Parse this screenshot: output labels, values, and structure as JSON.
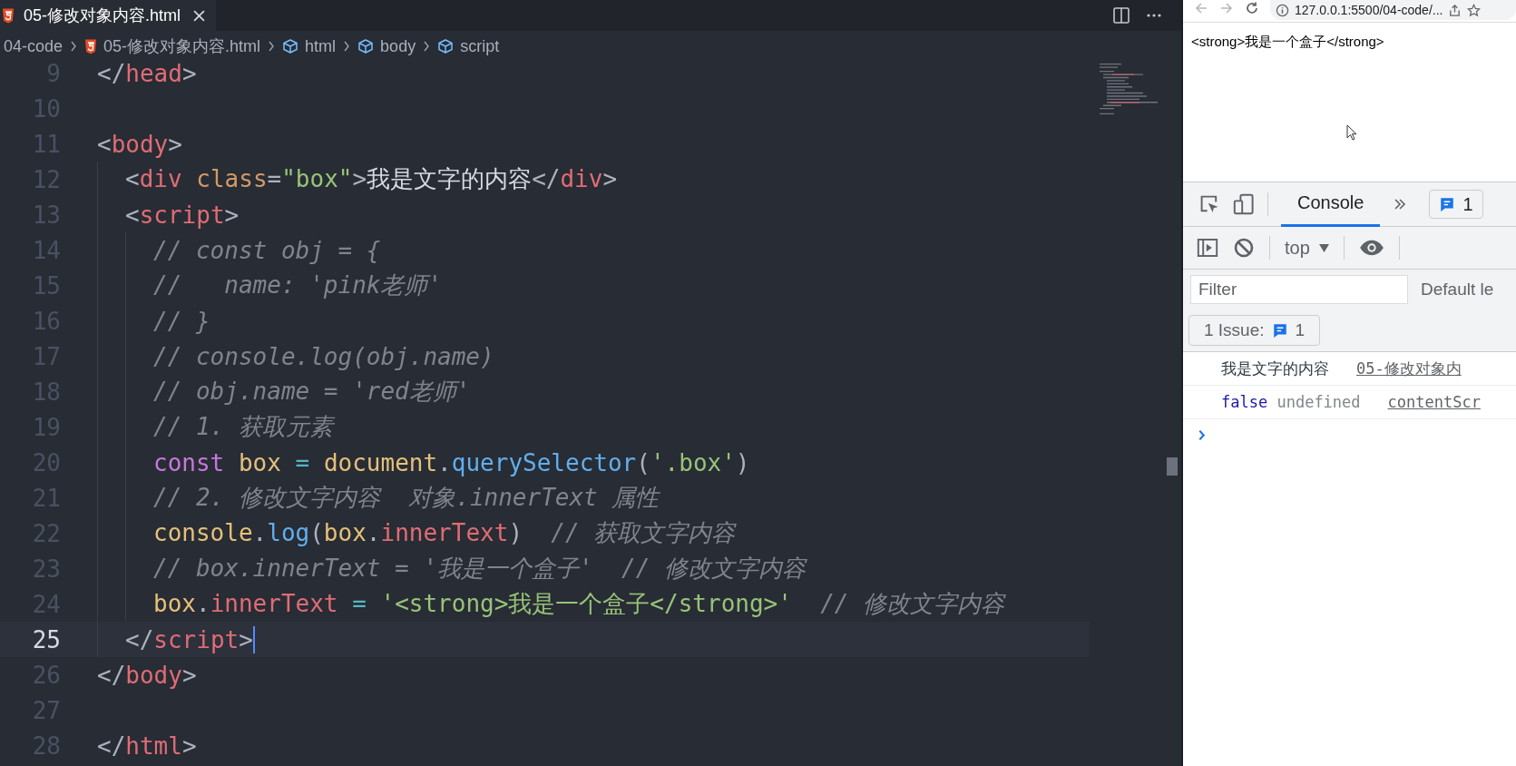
{
  "editor": {
    "tab": {
      "title": "05-修改对象内容.html",
      "selected": true
    },
    "breadcrumb": [
      {
        "label": "04-code",
        "kind": "folder"
      },
      {
        "label": "05-修改对象内容.html",
        "kind": "file"
      },
      {
        "label": "html",
        "kind": "element"
      },
      {
        "label": "body",
        "kind": "element"
      },
      {
        "label": "script",
        "kind": "element"
      }
    ],
    "lines": [
      {
        "number": "9",
        "active": false,
        "tokens": [
          {
            "kind": "punct",
            "text": "</"
          },
          {
            "kind": "tag",
            "text": "head"
          },
          {
            "kind": "punct",
            "text": ">"
          }
        ]
      },
      {
        "number": "10",
        "active": false
      },
      {
        "number": "11",
        "active": false,
        "tokens": [
          {
            "kind": "punct",
            "text": "<"
          },
          {
            "kind": "tag",
            "text": "body"
          },
          {
            "kind": "punct",
            "text": ">"
          }
        ]
      },
      {
        "number": "12",
        "active": false,
        "tokens": [
          {
            "kind": "punct",
            "text": "  <"
          },
          {
            "kind": "tag",
            "text": "div"
          },
          {
            "kind": "attr",
            "text": " class"
          },
          {
            "kind": "punct",
            "text": "="
          },
          {
            "kind": "string",
            "text": "\"box\""
          },
          {
            "kind": "punct",
            "text": ">"
          },
          {
            "kind": "plain",
            "text": "我是文字的内容"
          },
          {
            "kind": "punct",
            "text": "</"
          },
          {
            "kind": "tag",
            "text": "div"
          },
          {
            "kind": "punct",
            "text": ">"
          }
        ]
      },
      {
        "number": "13",
        "active": false,
        "tokens": [
          {
            "kind": "punct",
            "text": "  <"
          },
          {
            "kind": "tag",
            "text": "script"
          },
          {
            "kind": "punct",
            "text": ">"
          }
        ]
      },
      {
        "number": "14",
        "active": false,
        "tokens": [
          {
            "kind": "comment",
            "text": "    // const obj = {"
          }
        ]
      },
      {
        "number": "15",
        "active": false,
        "tokens": [
          {
            "kind": "comment",
            "text": "    //   name: 'pink老师'"
          }
        ]
      },
      {
        "number": "16",
        "active": false,
        "tokens": [
          {
            "kind": "comment",
            "text": "    // }"
          }
        ]
      },
      {
        "number": "17",
        "active": false,
        "tokens": [
          {
            "kind": "comment",
            "text": "    // console.log(obj.name)"
          }
        ]
      },
      {
        "number": "18",
        "active": false,
        "tokens": [
          {
            "kind": "comment",
            "text": "    // obj.name = 'red老师'"
          }
        ]
      },
      {
        "number": "19",
        "active": false,
        "tokens": [
          {
            "kind": "comment",
            "text": "    // 1. 获取元素"
          }
        ]
      },
      {
        "number": "20",
        "active": false,
        "tokens": [
          {
            "kind": "keyword",
            "text": "    const"
          },
          {
            "kind": "variable",
            "text": " box"
          },
          {
            "kind": "operator",
            "text": " = "
          },
          {
            "kind": "variable",
            "text": "document"
          },
          {
            "kind": "punct",
            "text": "."
          },
          {
            "kind": "func",
            "text": "querySelector"
          },
          {
            "kind": "punct",
            "text": "("
          },
          {
            "kind": "string",
            "text": "'.box'"
          },
          {
            "kind": "punct",
            "text": ")"
          }
        ]
      },
      {
        "number": "21",
        "active": false,
        "tokens": [
          {
            "kind": "comment",
            "text": "    // 2. 修改文字内容  对象.innerText 属性"
          }
        ]
      },
      {
        "number": "22",
        "active": false,
        "tokens": [
          {
            "kind": "variable",
            "text": "    console"
          },
          {
            "kind": "punct",
            "text": "."
          },
          {
            "kind": "func",
            "text": "log"
          },
          {
            "kind": "punct",
            "text": "("
          },
          {
            "kind": "variable",
            "text": "box"
          },
          {
            "kind": "punct",
            "text": "."
          },
          {
            "kind": "prop",
            "text": "innerText"
          },
          {
            "kind": "punct",
            "text": ")"
          },
          {
            "kind": "comment",
            "text": "  // 获取文字内容"
          }
        ]
      },
      {
        "number": "23",
        "active": false,
        "tokens": [
          {
            "kind": "comment",
            "text": "    // box.innerText = '我是一个盒子'  // 修改文字内容"
          }
        ]
      },
      {
        "number": "24",
        "active": false,
        "tokens": [
          {
            "kind": "variable",
            "text": "    box"
          },
          {
            "kind": "punct",
            "text": "."
          },
          {
            "kind": "prop",
            "text": "innerText"
          },
          {
            "kind": "operator",
            "text": " = "
          },
          {
            "kind": "string",
            "text": "'<strong>我是一个盒子</strong>'"
          },
          {
            "kind": "comment",
            "text": "  // 修改文字内容"
          }
        ]
      },
      {
        "number": "25",
        "active": true,
        "tokens": [
          {
            "kind": "punct",
            "text": "  </"
          },
          {
            "kind": "tag",
            "text": "script"
          },
          {
            "kind": "punct",
            "text": ">"
          }
        ]
      },
      {
        "number": "26",
        "active": false,
        "tokens": [
          {
            "kind": "punct",
            "text": "</"
          },
          {
            "kind": "tag",
            "text": "body"
          },
          {
            "kind": "punct",
            "text": ">"
          }
        ]
      },
      {
        "number": "27",
        "active": false
      },
      {
        "number": "28",
        "active": false,
        "tokens": [
          {
            "kind": "punct",
            "text": "</"
          },
          {
            "kind": "tag",
            "text": "html"
          },
          {
            "kind": "punct",
            "text": ">"
          }
        ]
      }
    ]
  },
  "browser": {
    "url": "127.0.0.1:5500/04-code/...",
    "page_text": "<strong>我是一个盒子</strong>",
    "devtools": {
      "tabs": [
        {
          "label": "Console",
          "selected": true
        }
      ],
      "issue_badge": "1",
      "context": "top",
      "filter": {
        "placeholder": "Filter"
      },
      "levels": "Default le",
      "issues": {
        "label": "1 Issue:",
        "count": "1"
      },
      "messages": [
        {
          "parts": [
            {
              "kind": "text",
              "text": "我是文字的内容"
            }
          ],
          "source": "05-修改对象内"
        },
        {
          "parts": [
            {
              "kind": "boolean",
              "text": "false"
            },
            {
              "kind": "undefined",
              "text": "undefined"
            }
          ],
          "source": "contentScr"
        }
      ]
    }
  }
}
